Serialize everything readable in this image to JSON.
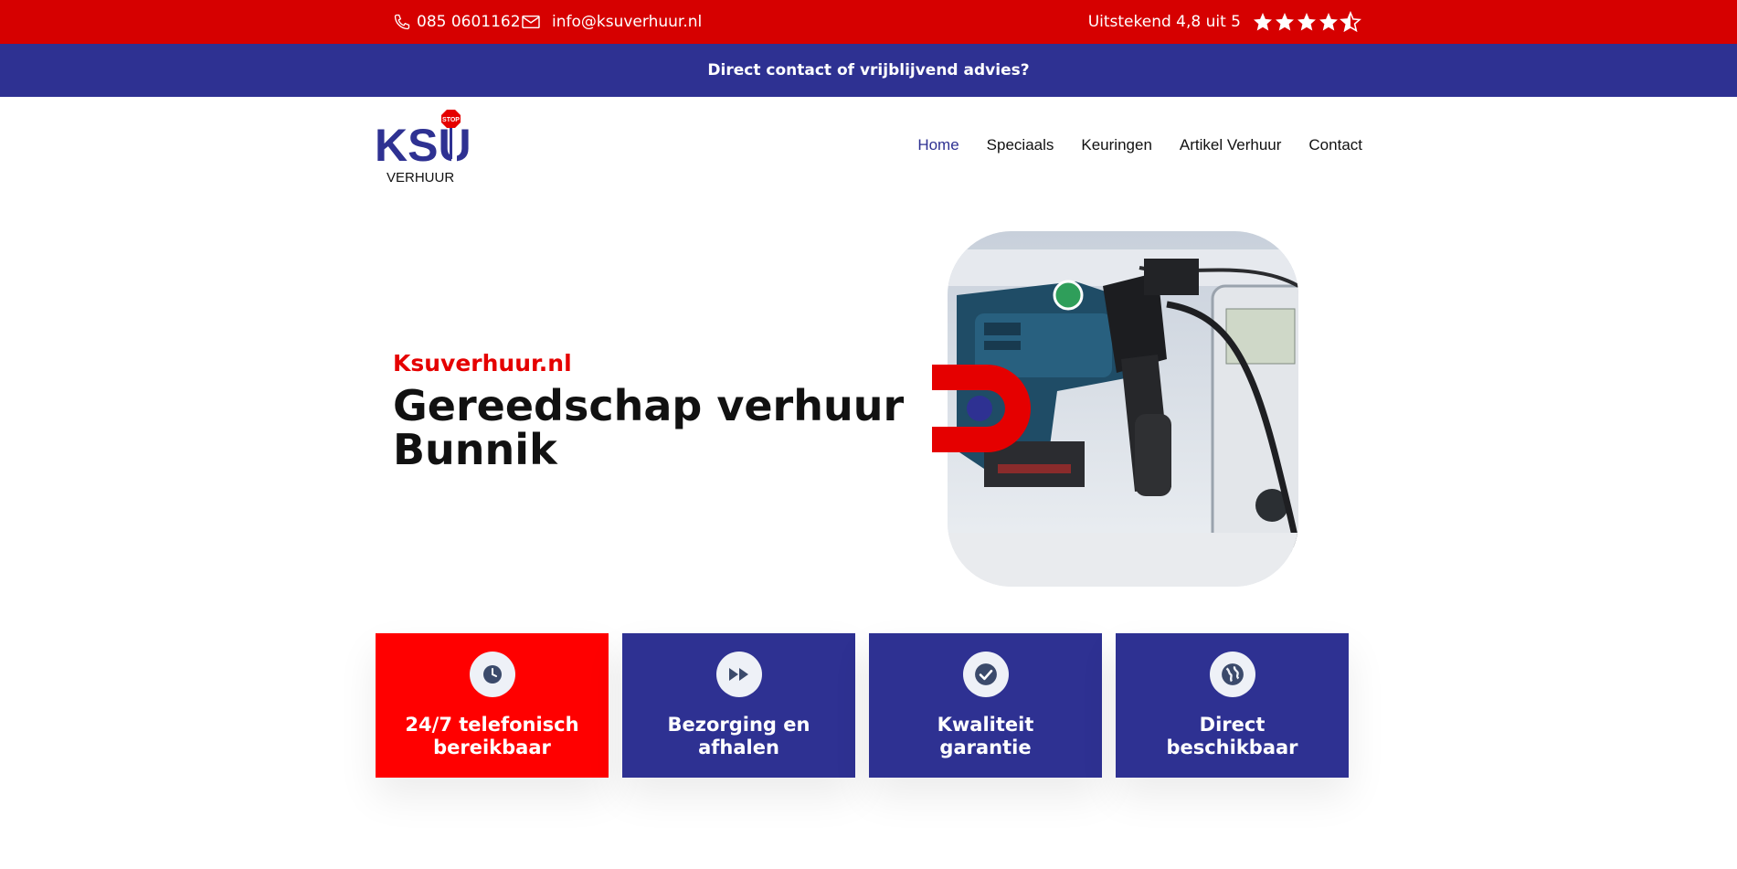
{
  "topbar": {
    "phone": "085 0601162",
    "email": "info@ksuverhuur.nl",
    "rating_text": "Uitstekend 4,8 uit 5",
    "rating_value": 4.5,
    "rating_max": 5
  },
  "advice": {
    "label": "Direct contact of vrijblijvend advies?"
  },
  "logo": {
    "brand": "KSU",
    "subtitle": "VERHUUR",
    "sign_text": "STOP"
  },
  "nav": {
    "items": [
      {
        "label": "Home",
        "active": true
      },
      {
        "label": "Speciaals",
        "active": false
      },
      {
        "label": "Keuringen",
        "active": false
      },
      {
        "label": "Artikel Verhuur",
        "active": false
      },
      {
        "label": "Contact",
        "active": false
      }
    ]
  },
  "hero": {
    "subtitle": "Ksuverhuur.nl",
    "title": "Gereedschap verhuur Bunnik"
  },
  "features": [
    {
      "label": "24/7 telefonisch bereikbaar",
      "icon": "clock-icon",
      "color": "#ff0000"
    },
    {
      "label": "Bezorging en afhalen",
      "icon": "fast-forward-icon",
      "color": "#2e3192"
    },
    {
      "label": "Kwaliteit garantie",
      "icon": "check-circle-icon",
      "color": "#2e3192"
    },
    {
      "label": "Direct beschikbaar",
      "icon": "globe-icon",
      "color": "#2e3192"
    }
  ],
  "colors": {
    "topbar": "#d60000",
    "brand_blue": "#2e3192",
    "accent_red": "#e50000"
  }
}
